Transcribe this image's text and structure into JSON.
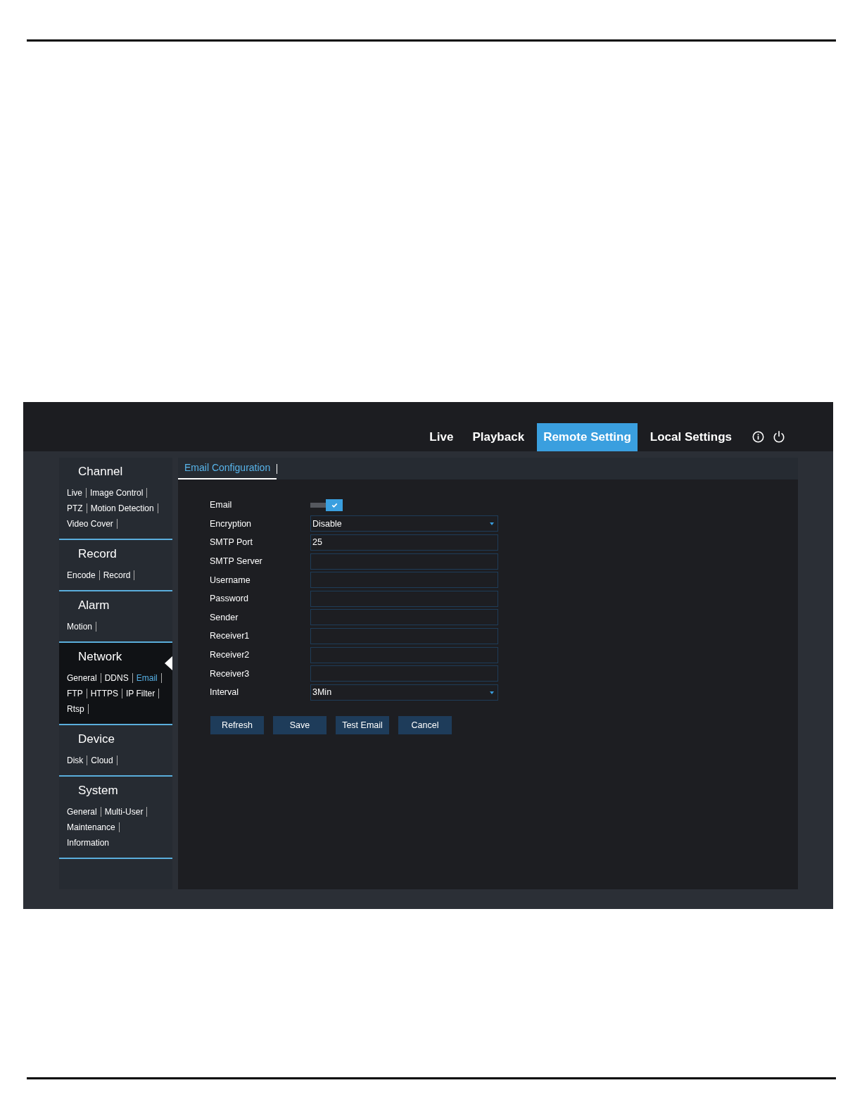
{
  "top_nav": {
    "items": [
      {
        "label": "Live",
        "selected": false
      },
      {
        "label": "Playback",
        "selected": false
      },
      {
        "label": "Remote Setting",
        "selected": true
      },
      {
        "label": "Local Settings",
        "selected": false
      }
    ]
  },
  "sidebar": {
    "sections": [
      {
        "title": "Channel",
        "selected": false,
        "rows": [
          [
            {
              "label": "Live",
              "selected": false,
              "divider": true
            },
            {
              "label": "Image Control",
              "selected": false,
              "divider": true
            }
          ],
          [
            {
              "label": "PTZ",
              "selected": false,
              "divider": true
            },
            {
              "label": "Motion Detection",
              "selected": false,
              "divider": true
            }
          ],
          [
            {
              "label": "Video Cover",
              "selected": false,
              "divider": true
            }
          ]
        ]
      },
      {
        "title": "Record",
        "selected": false,
        "rows": [
          [
            {
              "label": "Encode",
              "selected": false,
              "divider": true
            },
            {
              "label": "Record",
              "selected": false,
              "divider": true
            }
          ]
        ]
      },
      {
        "title": "Alarm",
        "selected": false,
        "rows": [
          [
            {
              "label": "Motion",
              "selected": false,
              "divider": true
            }
          ]
        ]
      },
      {
        "title": "Network",
        "selected": true,
        "rows": [
          [
            {
              "label": "General",
              "selected": false,
              "divider": true
            },
            {
              "label": "DDNS",
              "selected": false,
              "divider": true
            },
            {
              "label": "Email",
              "selected": true,
              "divider": true
            }
          ],
          [
            {
              "label": "FTP",
              "selected": false,
              "divider": true
            },
            {
              "label": "HTTPS",
              "selected": false,
              "divider": true
            },
            {
              "label": "IP Filter",
              "selected": false,
              "divider": true
            }
          ],
          [
            {
              "label": "Rtsp",
              "selected": false,
              "divider": true
            }
          ]
        ]
      },
      {
        "title": "Device",
        "selected": false,
        "rows": [
          [
            {
              "label": "Disk",
              "selected": false,
              "divider": true
            },
            {
              "label": "Cloud",
              "selected": false,
              "divider": true
            }
          ]
        ]
      },
      {
        "title": "System",
        "selected": false,
        "rows": [
          [
            {
              "label": "General",
              "selected": false,
              "divider": true
            },
            {
              "label": "Multi-User",
              "selected": false,
              "divider": true
            }
          ],
          [
            {
              "label": "Maintenance",
              "selected": false,
              "divider": true
            }
          ],
          [
            {
              "label": "Information",
              "selected": false,
              "divider": false
            }
          ]
        ]
      }
    ]
  },
  "tabs": [
    {
      "label": "Email Configuration",
      "selected": true
    }
  ],
  "form": {
    "rows": [
      {
        "kind": "toggle",
        "label": "Email",
        "checked": true
      },
      {
        "kind": "select",
        "label": "Encryption",
        "value": "Disable"
      },
      {
        "kind": "text",
        "label": "SMTP Port",
        "value": "25"
      },
      {
        "kind": "text",
        "label": "SMTP Server"
      },
      {
        "kind": "text",
        "label": "Username"
      },
      {
        "kind": "text",
        "label": "Password"
      },
      {
        "kind": "text",
        "label": "Sender"
      },
      {
        "kind": "text",
        "label": "Receiver1"
      },
      {
        "kind": "text",
        "label": "Receiver2"
      },
      {
        "kind": "text",
        "label": "Receiver3"
      },
      {
        "kind": "select",
        "label": "Interval",
        "value": "3Min"
      }
    ]
  },
  "buttons": [
    "Refresh",
    "Save",
    "Test Email",
    "Cancel"
  ]
}
